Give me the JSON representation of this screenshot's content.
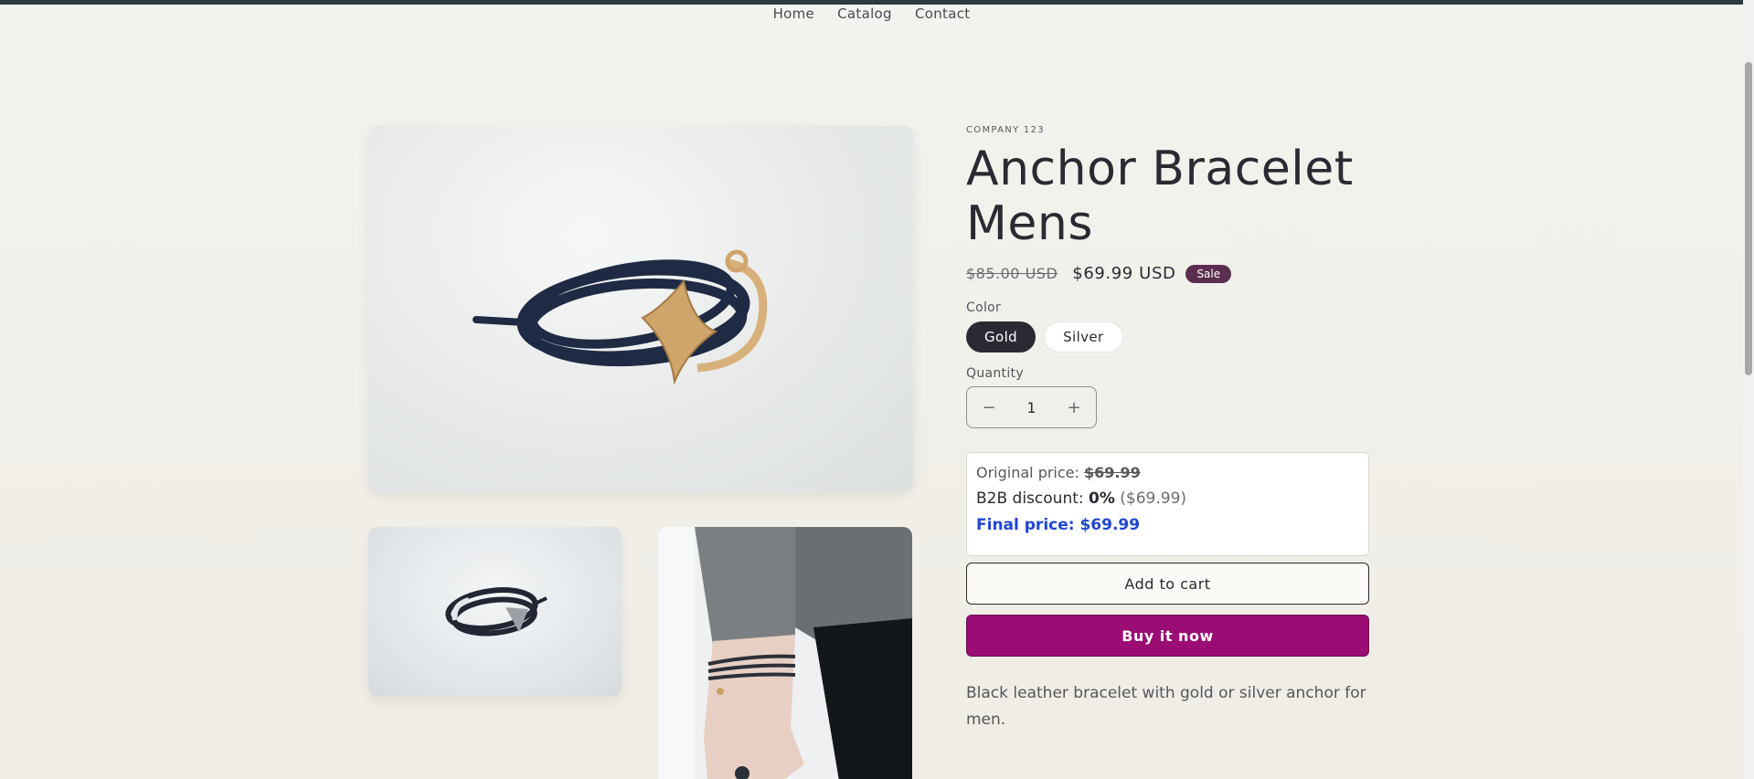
{
  "nav": {
    "home": "Home",
    "catalog": "Catalog",
    "contact": "Contact"
  },
  "product": {
    "vendor": "COMPANY 123",
    "title": "Anchor Bracelet Mens",
    "price_original": "$85.00 USD",
    "price_sale": "$69.99 USD",
    "badge": "Sale",
    "color_label": "Color",
    "colors": [
      {
        "label": "Gold",
        "selected": true
      },
      {
        "label": "Silver",
        "selected": false
      }
    ],
    "quantity_label": "Quantity",
    "quantity_value": "1",
    "minus_icon": "−",
    "plus_icon": "+",
    "description": "Black leather bracelet with gold or silver anchor for men."
  },
  "pricing_box": {
    "original_label": "Original price:",
    "original_value": "$69.99",
    "b2b_label": "B2B discount:",
    "b2b_value": "0%",
    "b2b_paren": "($69.99)",
    "final_label": "Final price: $69.99"
  },
  "buttons": {
    "add_to_cart": "Add to cart",
    "buy_now": "Buy it now"
  },
  "colors": {
    "accent": "#9b0c74",
    "badge": "#5b2d4e",
    "final_price": "#1f46d4",
    "header": "#2c3b3f"
  },
  "images": {
    "main": "bracelet-gold-anchor-photo",
    "thumb1": "bracelet-silver-anchor-photo",
    "thumb2": "wrist-model-photo"
  }
}
